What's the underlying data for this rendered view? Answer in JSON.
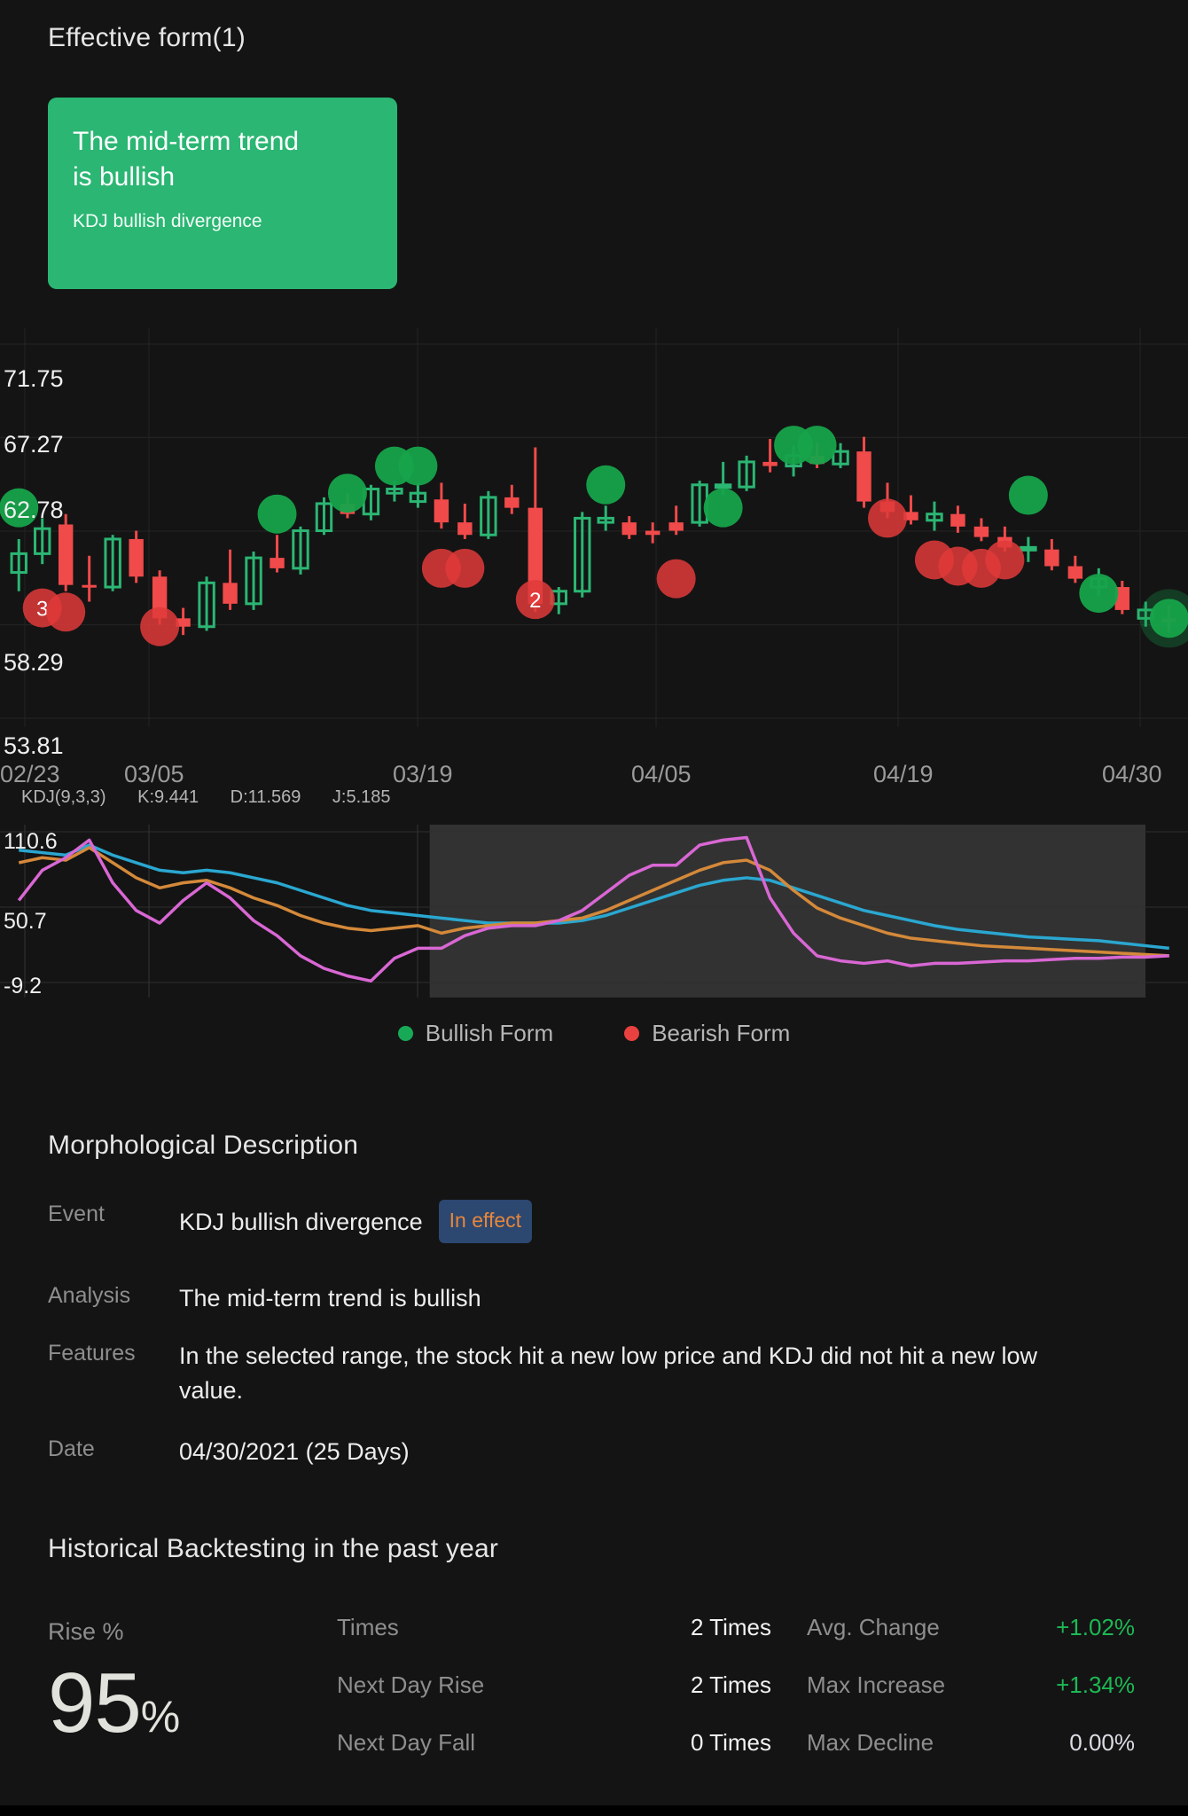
{
  "header": {
    "effective_form_title": "Effective form(1)",
    "card": {
      "headline": "The mid-term trend is bullish",
      "subtitle": "KDJ bullish divergence"
    }
  },
  "chart_data": [
    {
      "type": "candlestick",
      "name": "price-chart",
      "title": "",
      "xlabel": "",
      "ylabel": "",
      "grid": true,
      "ylim": [
        53.81,
        71.75
      ],
      "y_ticks": [
        "71.75",
        "67.27",
        "62.78",
        "58.29",
        "53.81"
      ],
      "x_ticks": [
        "02/23",
        "03/05",
        "03/19",
        "04/05",
        "04/19",
        "04/30"
      ],
      "colors": {
        "up": "#2bb673",
        "down": "#f04a4a",
        "bullish_marker": "#16a34a",
        "bearish_marker": "#e03a3a"
      },
      "candles": [
        {
          "o": 60.8,
          "h": 62.4,
          "l": 59.9,
          "c": 61.7,
          "dir": "up"
        },
        {
          "o": 61.7,
          "h": 63.4,
          "l": 61.2,
          "c": 62.9,
          "dir": "up"
        },
        {
          "o": 63.1,
          "h": 63.6,
          "l": 59.9,
          "c": 60.2,
          "dir": "down"
        },
        {
          "o": 60.2,
          "h": 61.6,
          "l": 59.4,
          "c": 60.1,
          "dir": "down"
        },
        {
          "o": 60.1,
          "h": 62.6,
          "l": 59.9,
          "c": 62.4,
          "dir": "up"
        },
        {
          "o": 62.4,
          "h": 62.8,
          "l": 60.3,
          "c": 60.6,
          "dir": "down"
        },
        {
          "o": 60.6,
          "h": 60.9,
          "l": 58.3,
          "c": 58.6,
          "dir": "down"
        },
        {
          "o": 58.6,
          "h": 59.1,
          "l": 57.8,
          "c": 58.2,
          "dir": "down"
        },
        {
          "o": 58.2,
          "h": 60.6,
          "l": 58.0,
          "c": 60.3,
          "dir": "up"
        },
        {
          "o": 60.3,
          "h": 61.9,
          "l": 59.0,
          "c": 59.3,
          "dir": "down"
        },
        {
          "o": 59.3,
          "h": 61.8,
          "l": 59.0,
          "c": 61.5,
          "dir": "up"
        },
        {
          "o": 61.5,
          "h": 62.6,
          "l": 60.8,
          "c": 61.0,
          "dir": "down"
        },
        {
          "o": 61.0,
          "h": 63.0,
          "l": 60.7,
          "c": 62.8,
          "dir": "up"
        },
        {
          "o": 62.8,
          "h": 64.4,
          "l": 62.6,
          "c": 64.1,
          "dir": "up"
        },
        {
          "o": 64.1,
          "h": 64.6,
          "l": 63.4,
          "c": 63.6,
          "dir": "down"
        },
        {
          "o": 63.6,
          "h": 65.0,
          "l": 63.3,
          "c": 64.8,
          "dir": "up"
        },
        {
          "o": 64.8,
          "h": 65.2,
          "l": 64.2,
          "c": 64.6,
          "dir": "up"
        },
        {
          "o": 64.6,
          "h": 65.1,
          "l": 63.9,
          "c": 64.2,
          "dir": "up"
        },
        {
          "o": 64.3,
          "h": 65.1,
          "l": 62.9,
          "c": 63.2,
          "dir": "down"
        },
        {
          "o": 63.2,
          "h": 64.1,
          "l": 62.4,
          "c": 62.6,
          "dir": "down"
        },
        {
          "o": 62.6,
          "h": 64.7,
          "l": 62.4,
          "c": 64.4,
          "dir": "up"
        },
        {
          "o": 64.4,
          "h": 65.0,
          "l": 63.6,
          "c": 63.9,
          "dir": "down"
        },
        {
          "o": 63.9,
          "h": 66.8,
          "l": 58.9,
          "c": 59.3,
          "dir": "down"
        },
        {
          "o": 59.3,
          "h": 60.1,
          "l": 58.8,
          "c": 59.9,
          "dir": "up"
        },
        {
          "o": 59.9,
          "h": 63.7,
          "l": 59.6,
          "c": 63.4,
          "dir": "up"
        },
        {
          "o": 63.4,
          "h": 64.0,
          "l": 62.8,
          "c": 63.2,
          "dir": "up"
        },
        {
          "o": 63.2,
          "h": 63.5,
          "l": 62.4,
          "c": 62.6,
          "dir": "down"
        },
        {
          "o": 62.6,
          "h": 63.2,
          "l": 62.2,
          "c": 62.8,
          "dir": "down"
        },
        {
          "o": 62.8,
          "h": 64.0,
          "l": 62.6,
          "c": 63.2,
          "dir": "down"
        },
        {
          "o": 63.2,
          "h": 65.2,
          "l": 63.0,
          "c": 65.0,
          "dir": "up"
        },
        {
          "o": 65.0,
          "h": 66.1,
          "l": 64.5,
          "c": 64.9,
          "dir": "up"
        },
        {
          "o": 64.9,
          "h": 66.4,
          "l": 64.7,
          "c": 66.1,
          "dir": "up"
        },
        {
          "o": 66.1,
          "h": 67.2,
          "l": 65.6,
          "c": 65.9,
          "dir": "down"
        },
        {
          "o": 65.9,
          "h": 66.9,
          "l": 65.4,
          "c": 66.4,
          "dir": "up"
        },
        {
          "o": 66.4,
          "h": 67.0,
          "l": 65.8,
          "c": 66.0,
          "dir": "down"
        },
        {
          "o": 66.0,
          "h": 67.0,
          "l": 65.8,
          "c": 66.6,
          "dir": "up"
        },
        {
          "o": 66.6,
          "h": 67.3,
          "l": 63.9,
          "c": 64.2,
          "dir": "down"
        },
        {
          "o": 64.2,
          "h": 65.1,
          "l": 63.4,
          "c": 63.7,
          "dir": "down"
        },
        {
          "o": 63.7,
          "h": 64.5,
          "l": 63.1,
          "c": 63.3,
          "dir": "down"
        },
        {
          "o": 63.3,
          "h": 64.2,
          "l": 62.8,
          "c": 63.6,
          "dir": "up"
        },
        {
          "o": 63.6,
          "h": 64.0,
          "l": 62.7,
          "c": 63.0,
          "dir": "down"
        },
        {
          "o": 63.0,
          "h": 63.4,
          "l": 62.3,
          "c": 62.5,
          "dir": "down"
        },
        {
          "o": 62.5,
          "h": 63.0,
          "l": 61.8,
          "c": 62.0,
          "dir": "down"
        },
        {
          "o": 62.0,
          "h": 62.5,
          "l": 61.3,
          "c": 61.9,
          "dir": "up"
        },
        {
          "o": 61.9,
          "h": 62.4,
          "l": 60.9,
          "c": 61.1,
          "dir": "down"
        },
        {
          "o": 61.1,
          "h": 61.6,
          "l": 60.3,
          "c": 60.5,
          "dir": "down"
        },
        {
          "o": 60.5,
          "h": 61.0,
          "l": 59.7,
          "c": 60.1,
          "dir": "up"
        },
        {
          "o": 60.1,
          "h": 60.4,
          "l": 58.8,
          "c": 59.0,
          "dir": "down"
        },
        {
          "o": 59.0,
          "h": 59.4,
          "l": 58.2,
          "c": 58.6,
          "dir": "up"
        },
        {
          "o": 58.6,
          "h": 59.2,
          "l": 57.9,
          "c": 58.4,
          "dir": "down"
        }
      ],
      "markers": [
        {
          "i": 0,
          "y": 63.9,
          "type": "bullish",
          "count": null
        },
        {
          "i": 1,
          "y": 59.1,
          "type": "bearish",
          "count": "3"
        },
        {
          "i": 2,
          "y": 58.9,
          "type": "bearish",
          "count": null
        },
        {
          "i": 6,
          "y": 58.2,
          "type": "bearish",
          "count": null
        },
        {
          "i": 11,
          "y": 63.6,
          "type": "bullish",
          "count": null
        },
        {
          "i": 14,
          "y": 64.6,
          "type": "bullish",
          "count": null
        },
        {
          "i": 16,
          "y": 65.9,
          "type": "bullish",
          "count": null
        },
        {
          "i": 17,
          "y": 65.9,
          "type": "bullish",
          "count": null
        },
        {
          "i": 18,
          "y": 61.0,
          "type": "bearish",
          "count": null
        },
        {
          "i": 19,
          "y": 61.0,
          "type": "bearish",
          "count": null
        },
        {
          "i": 22,
          "y": 59.5,
          "type": "bearish",
          "count": "2"
        },
        {
          "i": 25,
          "y": 65.0,
          "type": "bullish",
          "count": null
        },
        {
          "i": 28,
          "y": 60.5,
          "type": "bearish",
          "count": null
        },
        {
          "i": 30,
          "y": 63.9,
          "type": "bullish",
          "count": null
        },
        {
          "i": 33,
          "y": 66.9,
          "type": "bullish",
          "count": null
        },
        {
          "i": 34,
          "y": 66.9,
          "type": "bullish",
          "count": null
        },
        {
          "i": 37,
          "y": 63.4,
          "type": "bearish",
          "count": null
        },
        {
          "i": 39,
          "y": 61.4,
          "type": "bearish",
          "count": null
        },
        {
          "i": 40,
          "y": 61.1,
          "type": "bearish",
          "count": null
        },
        {
          "i": 41,
          "y": 61.0,
          "type": "bearish",
          "count": null
        },
        {
          "i": 42,
          "y": 61.4,
          "type": "bearish",
          "count": null
        },
        {
          "i": 43,
          "y": 64.5,
          "type": "bullish",
          "count": null
        },
        {
          "i": 46,
          "y": 59.8,
          "type": "bullish",
          "count": null
        },
        {
          "i": 49,
          "y": 58.6,
          "type": "bullish-selected",
          "count": null
        }
      ]
    },
    {
      "type": "line",
      "name": "kdj-chart",
      "title": "KDJ",
      "ylim": [
        -9.2,
        110.6
      ],
      "y_ticks": [
        "110.6",
        "50.7",
        "-9.2"
      ],
      "grid": true,
      "selection_start_index": 18,
      "series": [
        {
          "name": "K",
          "color": "#2aa7d0",
          "values": [
            96,
            94,
            92,
            100,
            92,
            86,
            80,
            78,
            80,
            78,
            74,
            70,
            64,
            58,
            52,
            48,
            46,
            44,
            42,
            40,
            38,
            38,
            38,
            38,
            40,
            44,
            50,
            56,
            62,
            68,
            72,
            74,
            72,
            66,
            60,
            54,
            48,
            44,
            40,
            36,
            33,
            31,
            29,
            27,
            26,
            25,
            24,
            22,
            20,
            18
          ]
        },
        {
          "name": "D",
          "color": "#d4893a",
          "values": [
            86,
            90,
            88,
            98,
            86,
            74,
            66,
            70,
            72,
            66,
            58,
            52,
            44,
            38,
            34,
            32,
            34,
            36,
            30,
            34,
            36,
            38,
            38,
            40,
            42,
            48,
            56,
            64,
            72,
            80,
            86,
            88,
            80,
            64,
            50,
            42,
            36,
            30,
            26,
            24,
            22,
            20,
            19,
            18,
            17,
            16,
            15,
            14,
            13,
            12
          ]
        },
        {
          "name": "J",
          "color": "#d967d4",
          "values": [
            56,
            80,
            90,
            104,
            70,
            48,
            38,
            56,
            70,
            58,
            40,
            28,
            12,
            2,
            -4,
            -8,
            10,
            18,
            18,
            28,
            34,
            36,
            36,
            40,
            48,
            62,
            76,
            84,
            84,
            100,
            104,
            106,
            58,
            30,
            12,
            8,
            6,
            8,
            4,
            6,
            6,
            7,
            8,
            8,
            9,
            10,
            10,
            11,
            11,
            12
          ]
        }
      ],
      "params_label": "KDJ(9,3,3)",
      "readouts": [
        "K:9.441",
        "D:11.569",
        "J:5.185"
      ]
    }
  ],
  "legend": {
    "items": [
      {
        "label": "Bullish Form",
        "color": "#18a957",
        "icon": "bullish-dot-icon"
      },
      {
        "label": "Bearish Form",
        "color": "#e8413f",
        "icon": "bearish-dot-icon"
      }
    ]
  },
  "morphological": {
    "title": "Morphological Description",
    "rows": [
      {
        "key": "Event",
        "value": "KDJ bullish divergence",
        "badge": "In effect"
      },
      {
        "key": "Analysis",
        "value": "The mid-term trend is bullish",
        "badge": null
      },
      {
        "key": "Features",
        "value": "In the selected range, the stock hit a new low price and KDJ did not hit a new low value.",
        "badge": null
      },
      {
        "key": "Date",
        "value": "04/30/2021 (25 Days)",
        "badge": null
      }
    ]
  },
  "backtesting": {
    "title": "Historical Backtesting in the past year",
    "rise_label": "Rise %",
    "rise_value": "95",
    "rise_unit": "%",
    "stats": [
      {
        "key": "Times",
        "value": "2 Times",
        "key2": "Avg. Change",
        "value2": "+1.02%",
        "tone": "pos"
      },
      {
        "key": "Next Day Rise",
        "value": "2 Times",
        "key2": "Max Increase",
        "value2": "+1.34%",
        "tone": "pos"
      },
      {
        "key": "Next Day Fall",
        "value": "0 Times",
        "key2": "Max Decline",
        "value2": "0.00%",
        "tone": "neutral"
      }
    ]
  }
}
